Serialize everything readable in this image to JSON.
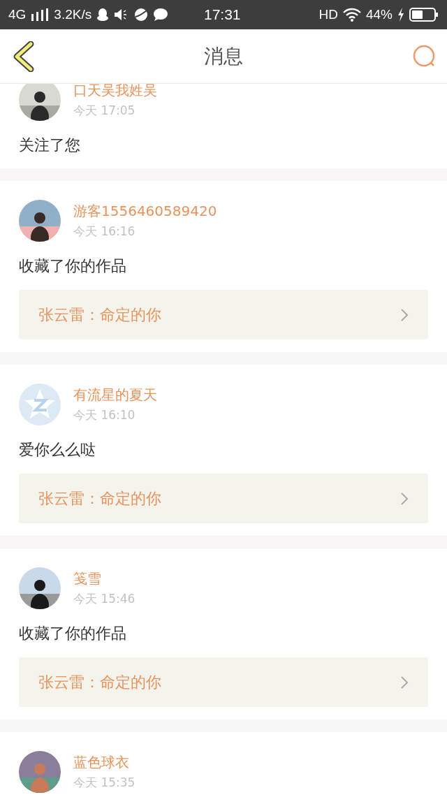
{
  "status_bar": {
    "network": "4G",
    "speed": "3.2K/s",
    "time": "17:31",
    "hd": "HD",
    "battery": "44%"
  },
  "header": {
    "title": "消息"
  },
  "messages": [
    {
      "kind": "picture",
      "name": "口天吴我姓吴",
      "time": "今天 17:05",
      "text": "关注了您"
    },
    {
      "kind": "picture",
      "name": "游客1556460589420",
      "time": "今天 16:16",
      "text": "收藏了你的作品",
      "quote": "张云雷：命定的你"
    },
    {
      "kind": "default",
      "name": "有流星的夏天",
      "time": "今天 16:10",
      "text": "爱你么么哒",
      "quote": "张云雷：命定的你"
    },
    {
      "kind": "picture",
      "name": "笺雪",
      "time": "今天 15:46",
      "text": "收藏了你的作品",
      "quote": "张云雷：命定的你"
    },
    {
      "kind": "picture",
      "name": "蓝色球衣",
      "time": "今天 15:35"
    }
  ]
}
